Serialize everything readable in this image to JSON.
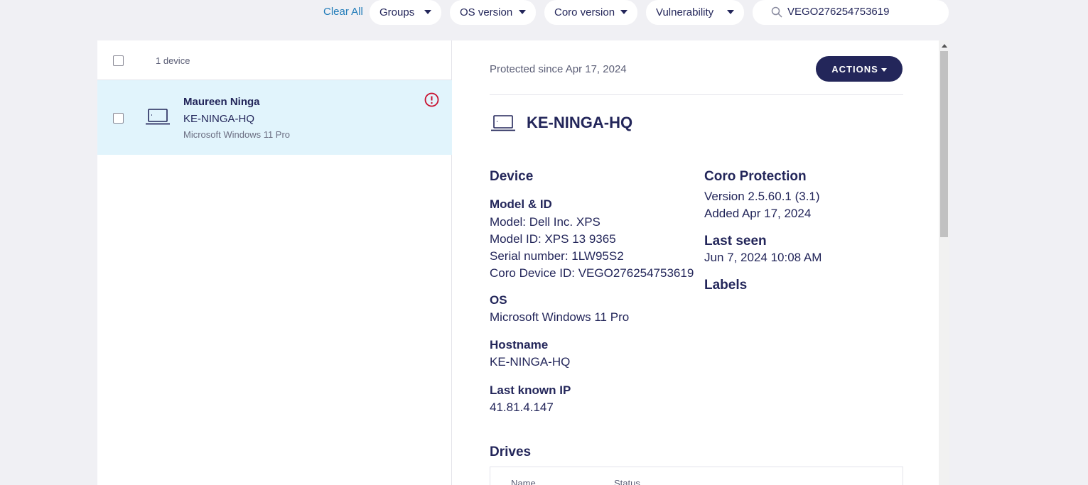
{
  "filters": {
    "clear_all": "Clear All",
    "groups": "Groups",
    "os_version": "OS version",
    "coro_version": "Coro version",
    "vulnerability": "Vulnerability",
    "search_value": "VEGO276254753619"
  },
  "list": {
    "count": "1 device",
    "rows": [
      {
        "user": "Maureen Ninga",
        "hostname": "KE-NINGA-HQ",
        "os": "Microsoft Windows 11 Pro"
      }
    ]
  },
  "detail": {
    "protected_since": "Protected since Apr 17, 2024",
    "actions": "ACTIONS",
    "title": "KE-NINGA-HQ",
    "device": {
      "heading": "Device",
      "model_id_heading": "Model & ID",
      "model": "Model: Dell Inc. XPS",
      "model_id": "Model ID: XPS 13 9365",
      "serial": "Serial number: 1LW95S2",
      "coro_device_id": "Coro Device ID: VEGO276254753619",
      "os_heading": "OS",
      "os": "Microsoft Windows 11 Pro",
      "hostname_heading": "Hostname",
      "hostname": "KE-NINGA-HQ",
      "ip_heading": "Last known IP",
      "ip": "41.81.4.147"
    },
    "protection": {
      "heading": "Coro Protection",
      "version": "Version 2.5.60.1 (3.1)",
      "added": "Added Apr 17, 2024",
      "last_seen_heading": "Last seen",
      "last_seen": "Jun 7, 2024 10:08 AM",
      "labels_heading": "Labels"
    },
    "drives": {
      "heading": "Drives",
      "col_name": "Name",
      "col_status": "Status"
    }
  },
  "colors": {
    "primary": "#23265a",
    "link": "#1e7ab8",
    "selected_row": "#e1f4fc",
    "alert": "#c8102e"
  }
}
